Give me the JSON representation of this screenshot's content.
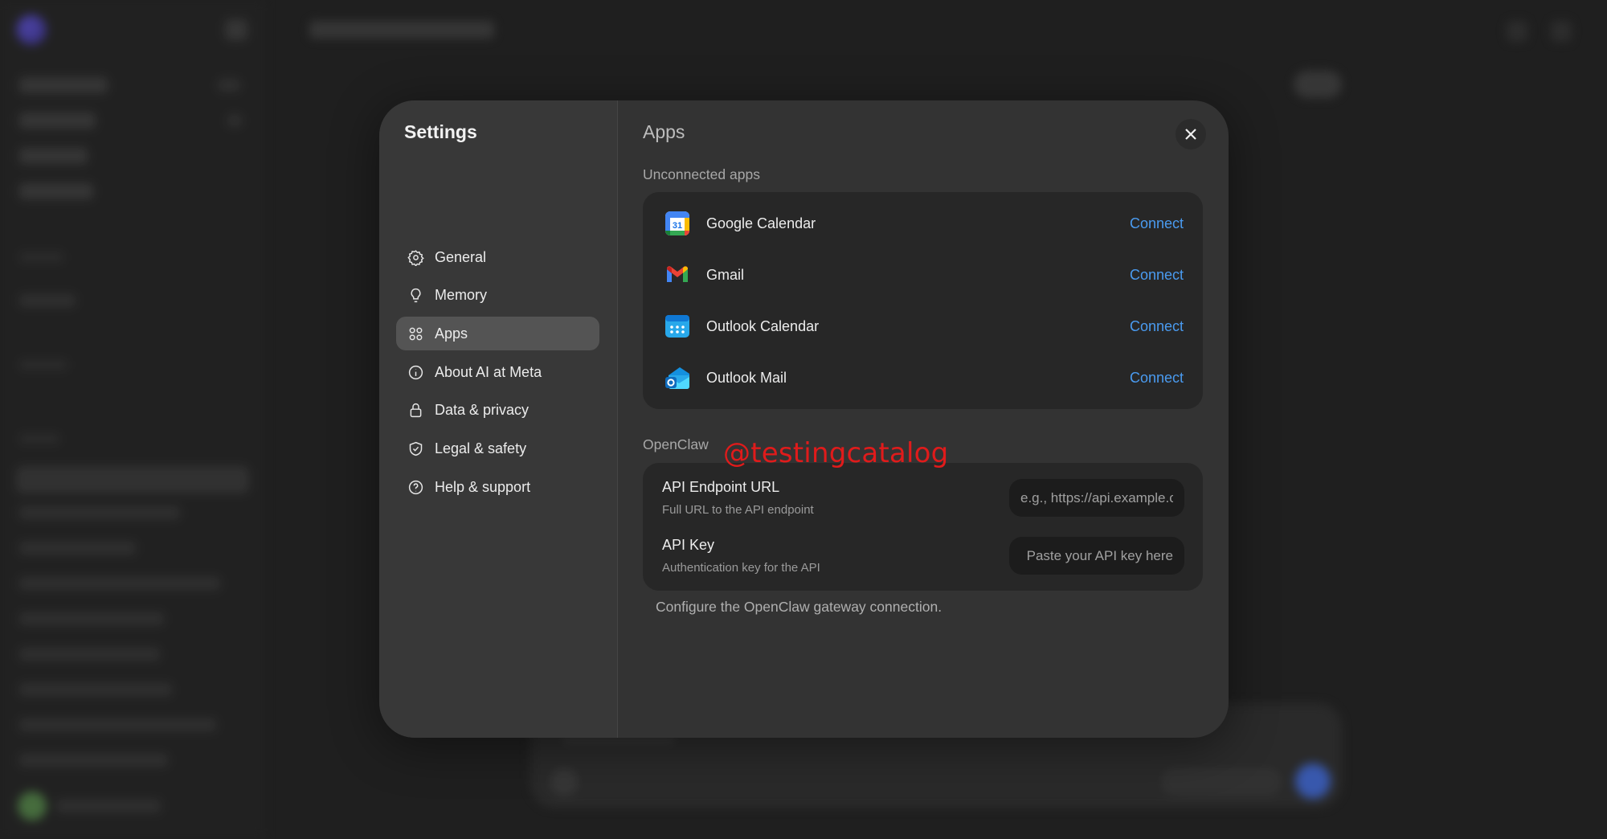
{
  "settings": {
    "title": "Settings",
    "nav": [
      {
        "label": "General",
        "icon": "gear-icon",
        "active": false
      },
      {
        "label": "Memory",
        "icon": "lightbulb-icon",
        "active": false
      },
      {
        "label": "Apps",
        "icon": "apps-grid-icon",
        "active": true
      },
      {
        "label": "About AI at Meta",
        "icon": "info-icon",
        "active": false
      },
      {
        "label": "Data & privacy",
        "icon": "lock-icon",
        "active": false
      },
      {
        "label": "Legal & safety",
        "icon": "shield-icon",
        "active": false
      },
      {
        "label": "Help & support",
        "icon": "help-icon",
        "active": false
      }
    ]
  },
  "apps_page": {
    "title": "Apps",
    "unconnected_label": "Unconnected apps",
    "apps": [
      {
        "name": "Google Calendar",
        "icon": "google-calendar-icon",
        "action": "Connect"
      },
      {
        "name": "Gmail",
        "icon": "gmail-icon",
        "action": "Connect"
      },
      {
        "name": "Outlook Calendar",
        "icon": "outlook-calendar-icon",
        "action": "Connect"
      },
      {
        "name": "Outlook Mail",
        "icon": "outlook-mail-icon",
        "action": "Connect"
      }
    ],
    "openclaw": {
      "label": "OpenClaw",
      "endpoint": {
        "title": "API Endpoint URL",
        "subtitle": "Full URL to the API endpoint",
        "placeholder": "e.g., https://api.example.com",
        "value": ""
      },
      "api_key": {
        "title": "API Key",
        "subtitle": "Authentication key for the API",
        "placeholder": "Paste your API key here",
        "value": ""
      },
      "helper": "Configure the OpenClaw gateway connection."
    }
  },
  "watermark": "@testingcatalog",
  "colors": {
    "accent_link": "#4a9bf0",
    "modal_bg": "#333333",
    "card_bg": "#272727",
    "watermark": "#e01b1b"
  }
}
